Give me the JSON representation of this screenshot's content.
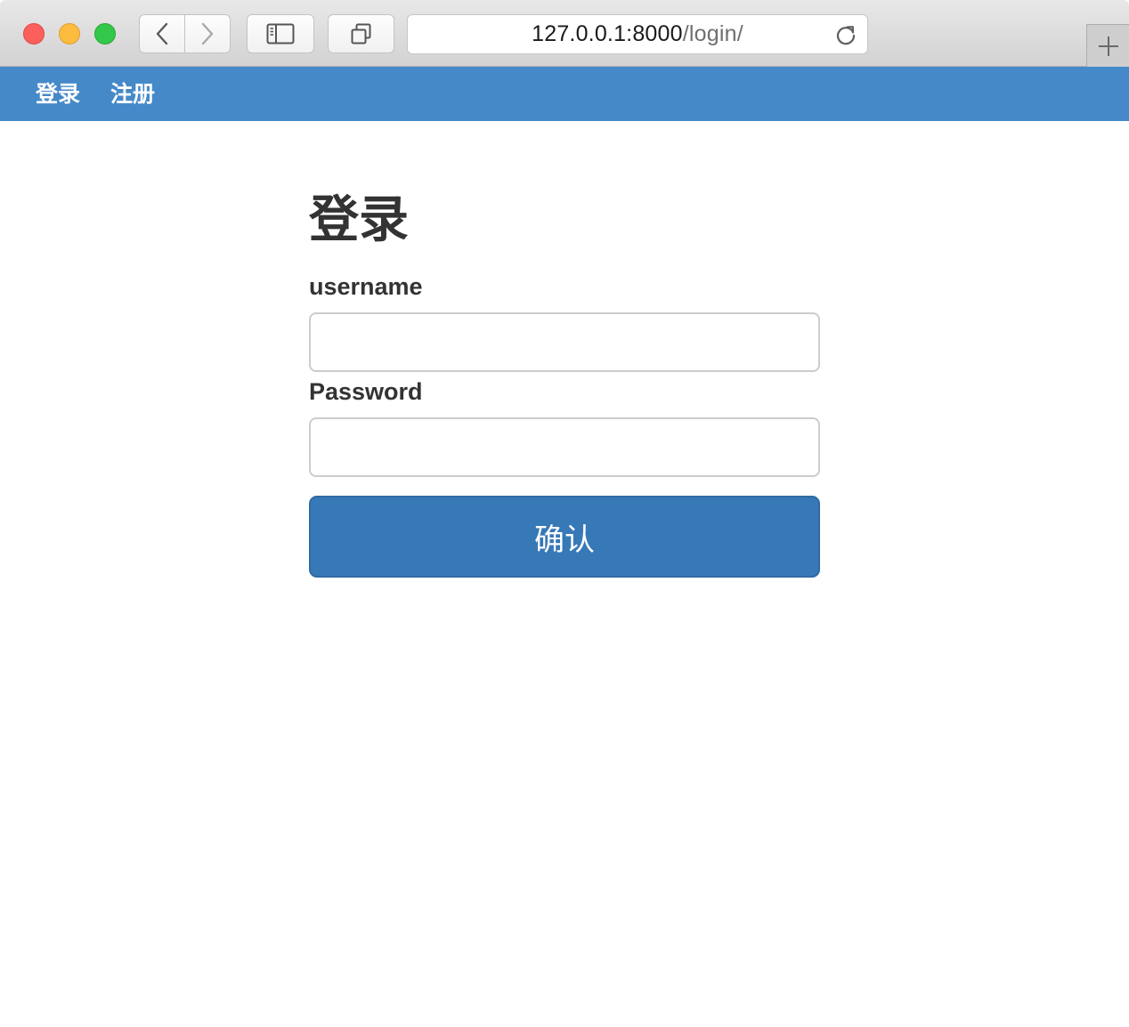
{
  "browser": {
    "url_host": "127.0.0.1:8000",
    "url_path": "/login/"
  },
  "nav": {
    "items": [
      {
        "label": "登录"
      },
      {
        "label": "注册"
      }
    ],
    "background_color": "#4589c9"
  },
  "login_form": {
    "title": "登录",
    "username_label": "username",
    "username_value": "",
    "password_label": "Password",
    "password_value": "",
    "submit_label": "确认",
    "submit_color": "#3778b7"
  }
}
